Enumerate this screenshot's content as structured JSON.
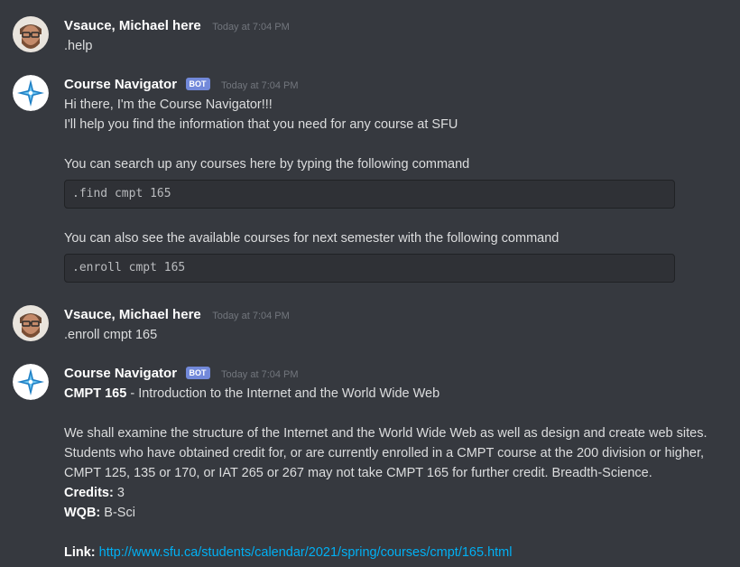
{
  "messages": [
    {
      "username": "Vsauce, Michael here",
      "timestamp": "Today at 7:04 PM",
      "text": ".help"
    },
    {
      "username": "Course Navigator",
      "bot_tag": "BOT",
      "timestamp": "Today at 7:04 PM",
      "line1": "Hi there, I'm the Course Navigator!!!",
      "line2": "I'll help you find the information that you need for any course at SFU",
      "line3": "You can search up any courses here by typing the following command",
      "code1": ".find cmpt 165",
      "line4": "You can also see the available courses for next semester with the following command",
      "code2": ".enroll cmpt 165"
    },
    {
      "username": "Vsauce, Michael here",
      "timestamp": "Today at 7:04 PM",
      "text": ".enroll cmpt 165"
    },
    {
      "username": "Course Navigator",
      "bot_tag": "BOT",
      "timestamp": "Today at 7:04 PM",
      "course_code": "CMPT 165",
      "course_title": " - Introduction to the Internet and the World Wide Web",
      "desc1": "We shall examine the structure of the Internet and the World Wide Web as well as design and create web sites.",
      "desc2": "Students who have obtained credit for, or are currently enrolled in a CMPT course at the 200 division or higher,",
      "desc3": "CMPT 125, 135 or 170, or IAT 265 or 267 may not take CMPT 165 for further credit. Breadth-Science.",
      "credits_label": "Credits:",
      "credits_value": " 3",
      "wqb_label": "WQB:",
      "wqb_value": " B-Sci",
      "link_label": "Link:",
      "link_url": "http://www.sfu.ca/students/calendar/2021/spring/courses/cmpt/165.html"
    }
  ],
  "colors": {
    "background": "#36393f",
    "code_block": "#2f3136",
    "bot_tag": "#7289da",
    "link": "#00b0f4",
    "timestamp": "#72767d"
  },
  "icons": {
    "user_avatar": "bearded-man-avatar",
    "bot_avatar": "compass-star-avatar"
  }
}
